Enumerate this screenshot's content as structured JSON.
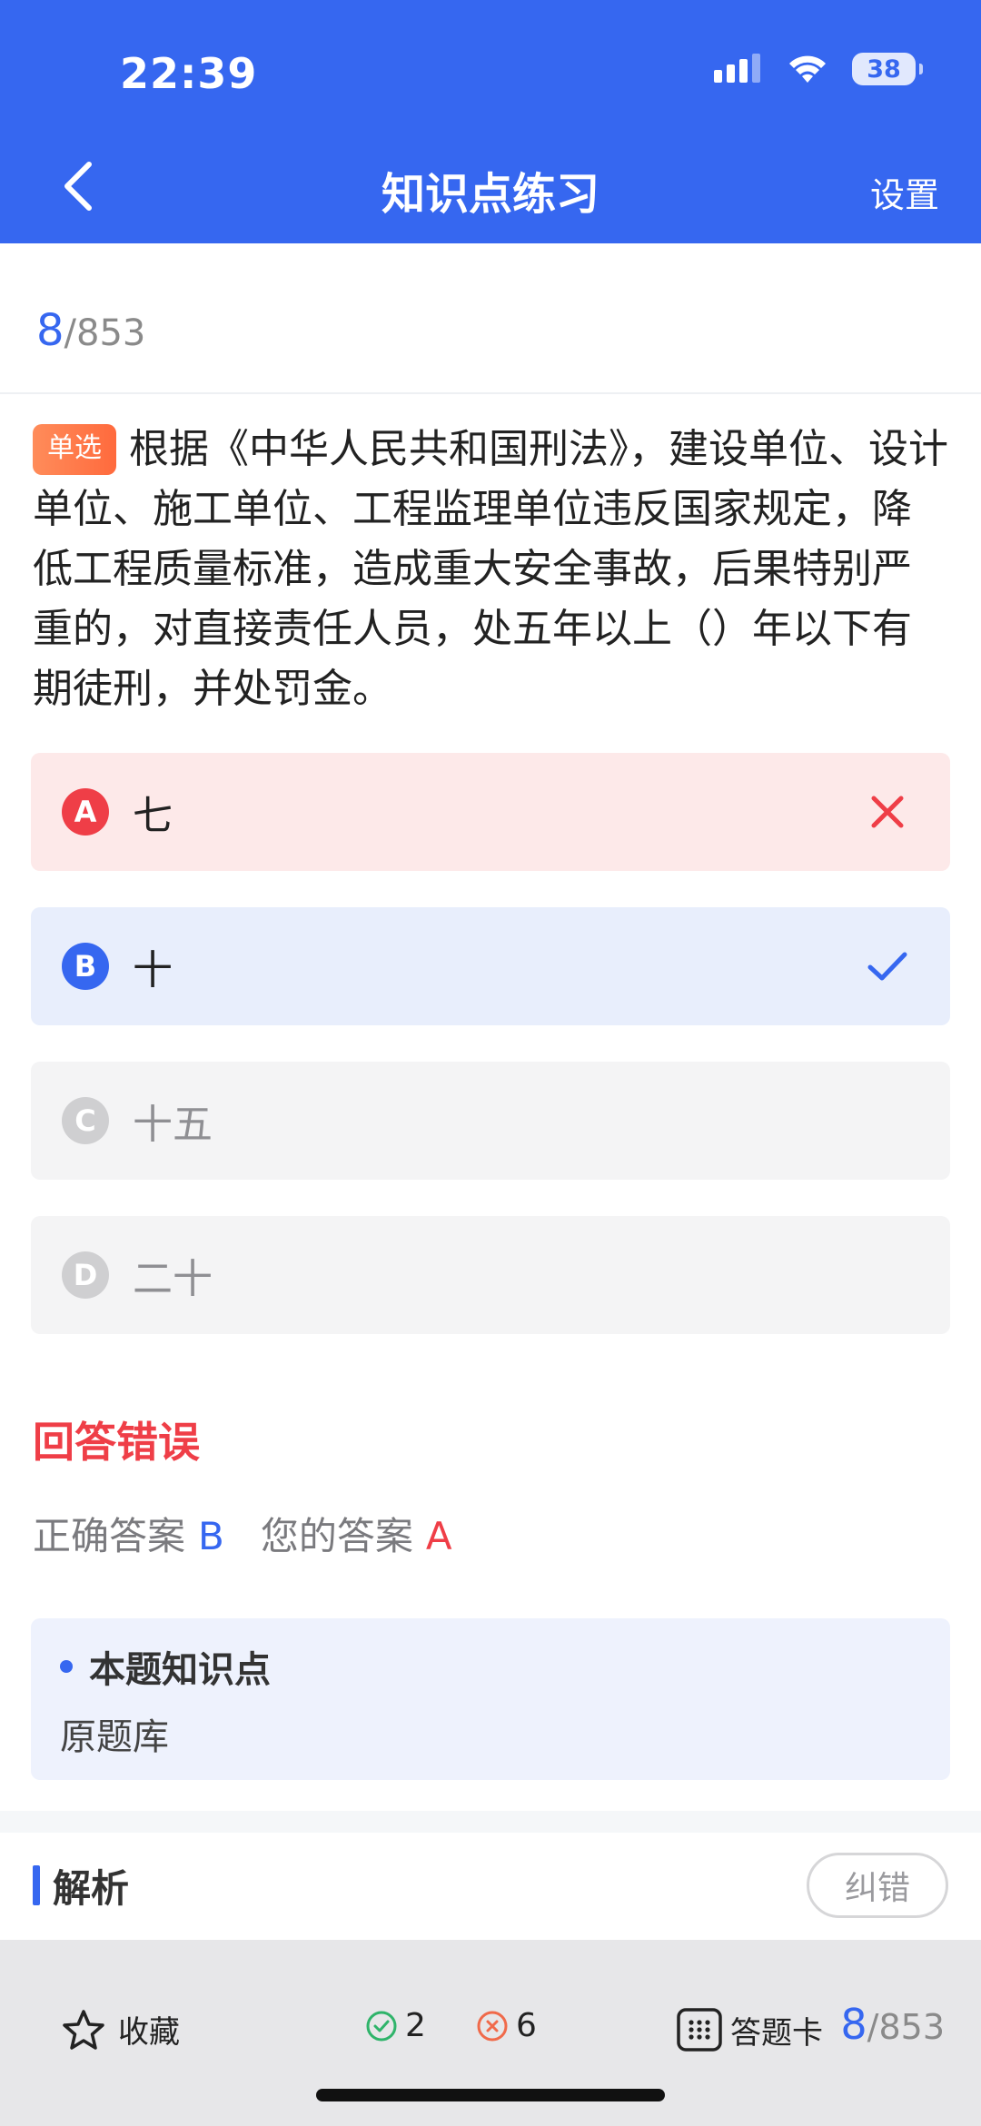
{
  "status_bar": {
    "time": "22:39",
    "battery": "38"
  },
  "header": {
    "title": "知识点练习",
    "settings": "设置"
  },
  "progress": {
    "current": "8",
    "total": "/853"
  },
  "question": {
    "type": "单选",
    "text": "根据《中华人民共和国刑法》，建设单位、设计单位、施工单位、工程监理单位违反国家规定，降低工程质量标准，造成重大安全事故，后果特别严重的，对直接责任人员，处五年以上（）年以下有期徒刑，并处罚金。"
  },
  "options": [
    {
      "letter": "A",
      "text": "七",
      "state": "wrong"
    },
    {
      "letter": "B",
      "text": "十",
      "state": "correct"
    },
    {
      "letter": "C",
      "text": "十五",
      "state": "none"
    },
    {
      "letter": "D",
      "text": "二十",
      "state": "none"
    }
  ],
  "result": {
    "title": "回答错误",
    "correct_label": "正确答案",
    "correct_value": "B",
    "yours_label": "您的答案",
    "yours_value": "A"
  },
  "knowledge": {
    "title": "本题知识点",
    "value": "原题库"
  },
  "analysis": {
    "title": "解析",
    "report": "纠错"
  },
  "bottom_bar": {
    "favorite": "收藏",
    "right_count": "2",
    "wrong_count": "6",
    "answer_card": "答题卡",
    "current": "8",
    "total": "/853"
  },
  "colors": {
    "primary": "#3667f0",
    "error": "#ef3e47",
    "success": "#2fb46a",
    "type_tag": "#ff7a4a"
  }
}
